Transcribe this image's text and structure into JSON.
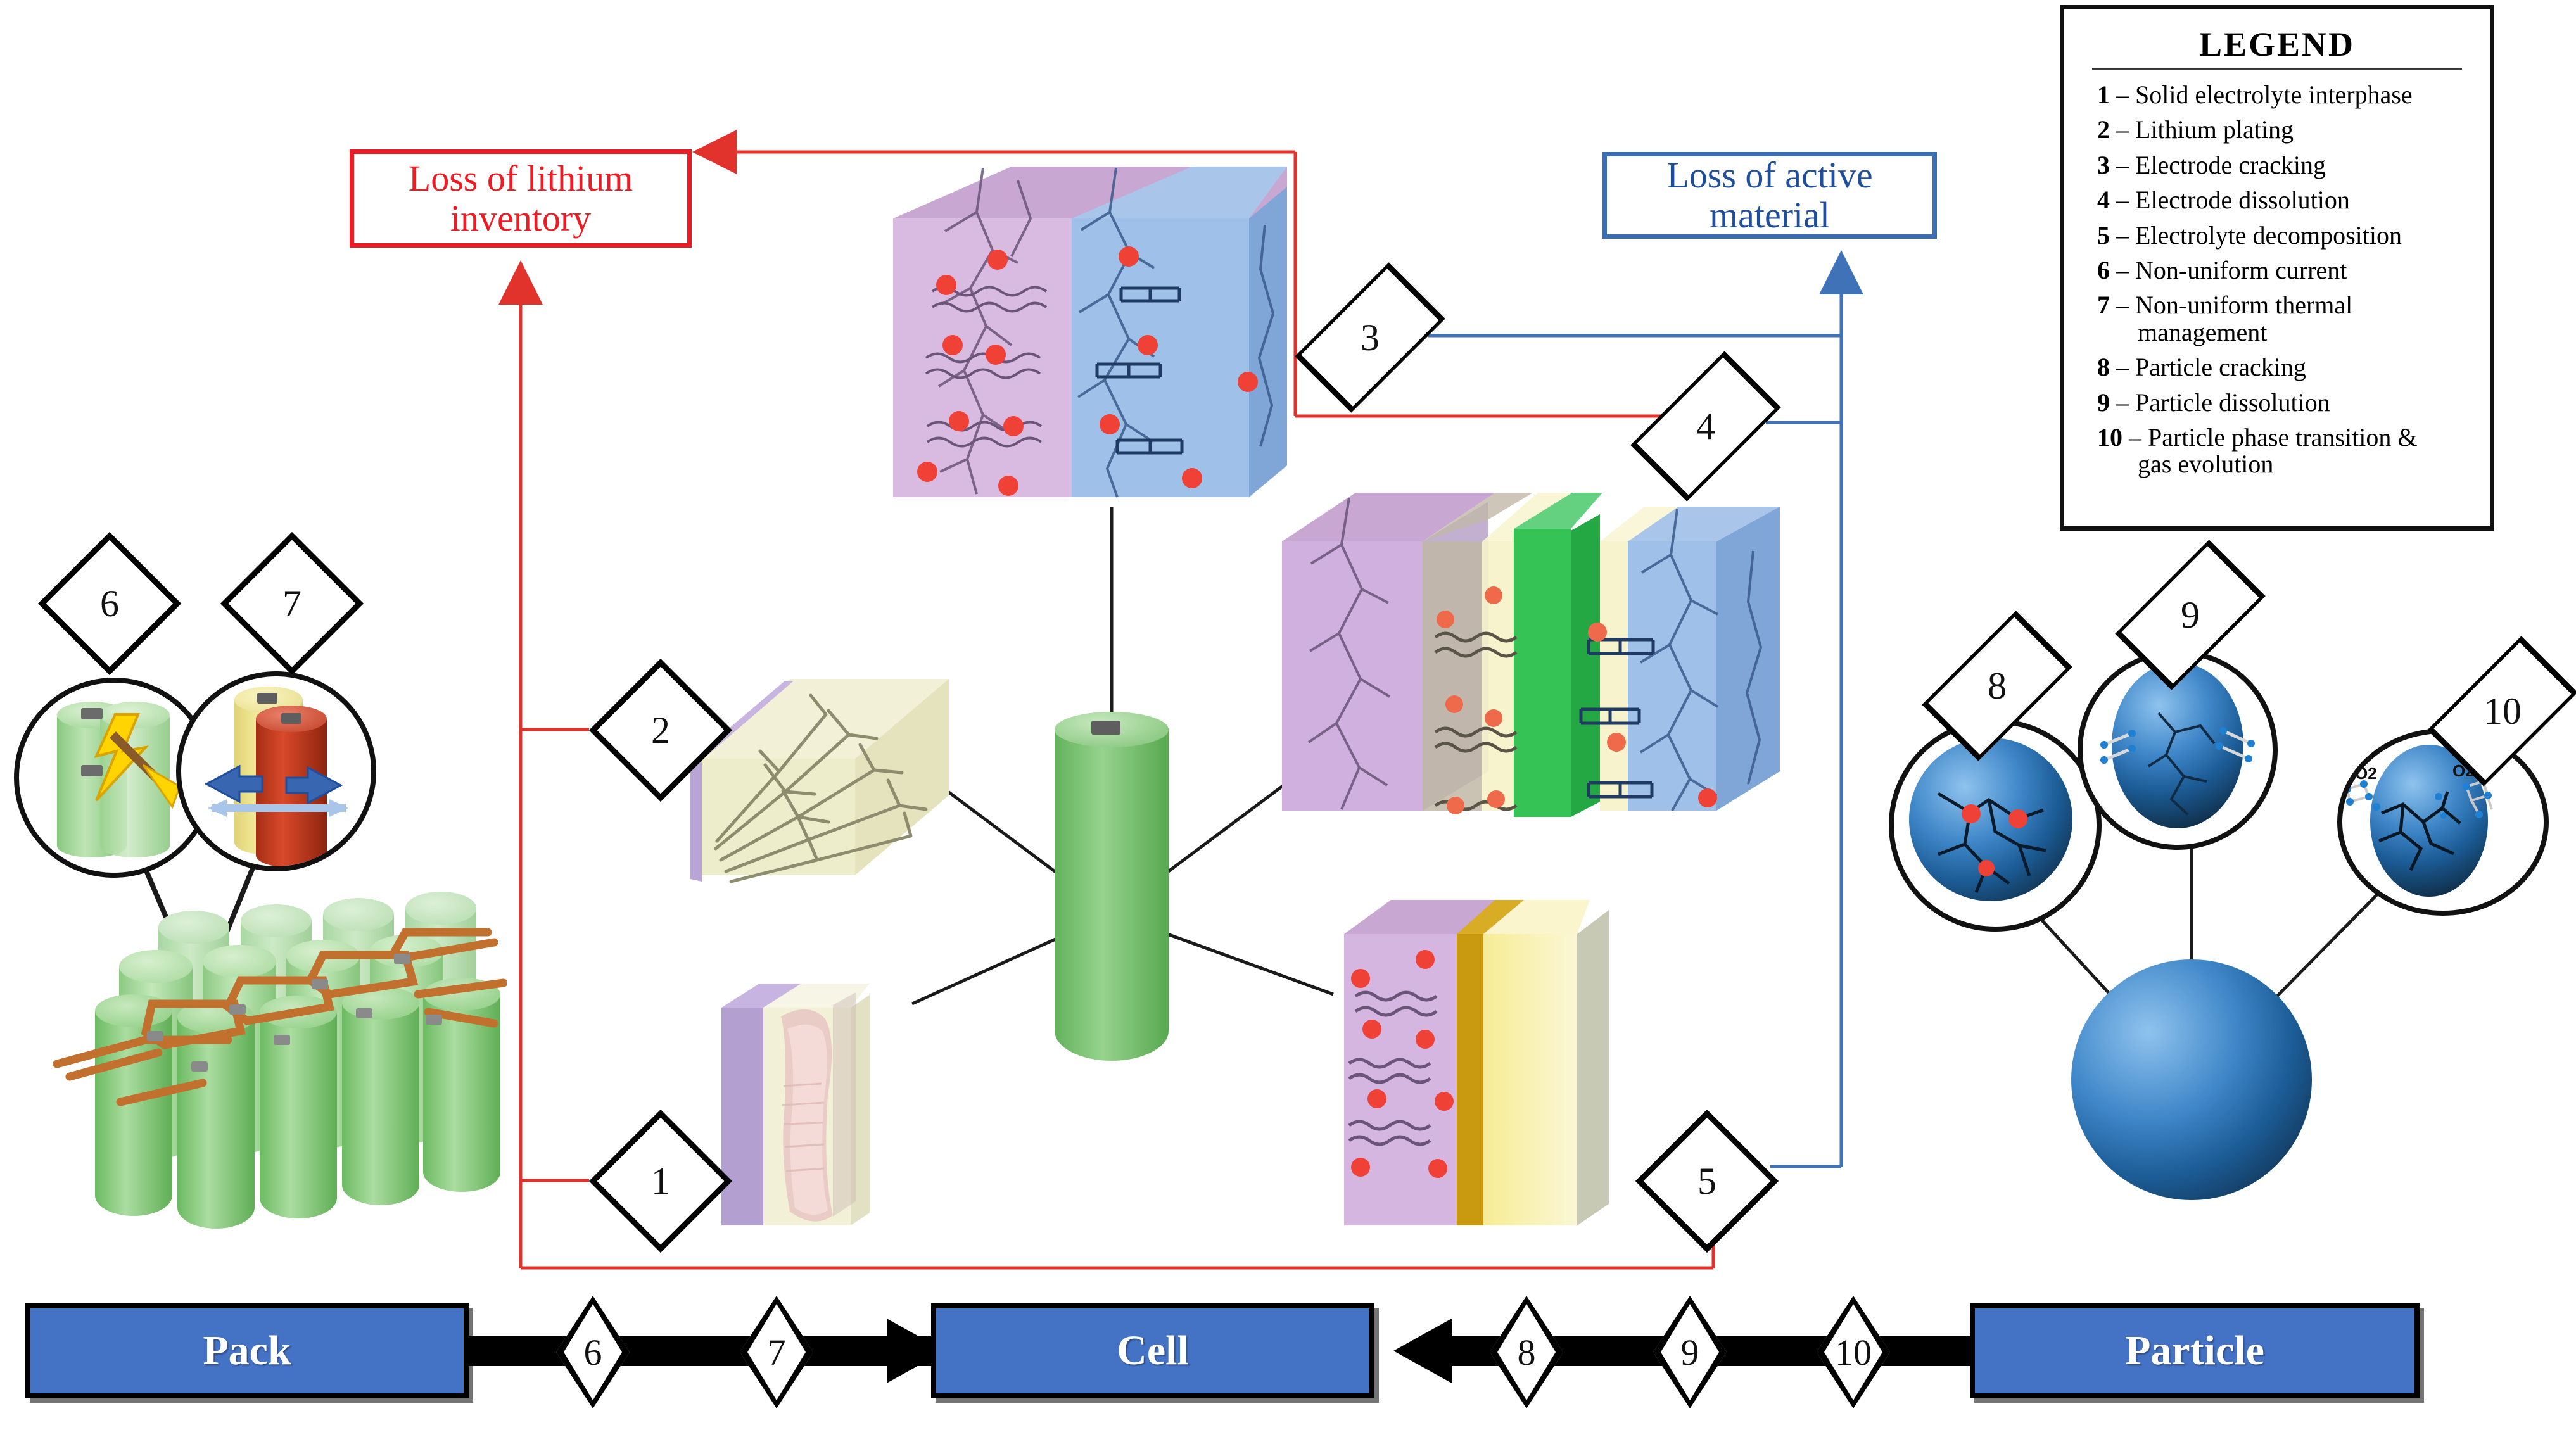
{
  "legend": {
    "title": "LEGEND",
    "items": [
      {
        "num": "1",
        "text": "Solid electrolyte interphase"
      },
      {
        "num": "2",
        "text": "Lithium plating"
      },
      {
        "num": "3",
        "text": "Electrode cracking"
      },
      {
        "num": "4",
        "text": "Electrode dissolution"
      },
      {
        "num": "5",
        "text": "Electrolyte decomposition"
      },
      {
        "num": "6",
        "text": "Non-uniform current"
      },
      {
        "num": "7",
        "text": "Non-uniform thermal",
        "cont": "management"
      },
      {
        "num": "8",
        "text": "Particle cracking"
      },
      {
        "num": "9",
        "text": "Particle dissolution"
      },
      {
        "num": "10",
        "text": "Particle phase transition &",
        "cont": "gas evolution"
      }
    ],
    "dash": "–"
  },
  "outcomes": {
    "loss_of_lithium_inventory": "Loss of lithium\ninventory",
    "loss_of_active_material": "Loss of active\nmaterial",
    "lli_color": "#ed1c24",
    "lam_color": "#1f4e9c"
  },
  "markers": [
    {
      "id": "m1",
      "label": "1"
    },
    {
      "id": "m2",
      "label": "2"
    },
    {
      "id": "m3",
      "label": "3"
    },
    {
      "id": "m4",
      "label": "4"
    },
    {
      "id": "m5",
      "label": "5"
    },
    {
      "id": "m6",
      "label": "6"
    },
    {
      "id": "m7",
      "label": "7"
    },
    {
      "id": "m8",
      "label": "8"
    },
    {
      "id": "m9",
      "label": "9"
    },
    {
      "id": "m10",
      "label": "10"
    }
  ],
  "scale_bar": {
    "pack": "Pack",
    "cell": "Cell",
    "particle": "Particle",
    "steps_left": [
      "6",
      "7"
    ],
    "steps_right": [
      "8",
      "9",
      "10"
    ],
    "box_color": "#4472c4"
  },
  "annotations": {
    "o2_left": "O2",
    "o2_right": "O2"
  }
}
